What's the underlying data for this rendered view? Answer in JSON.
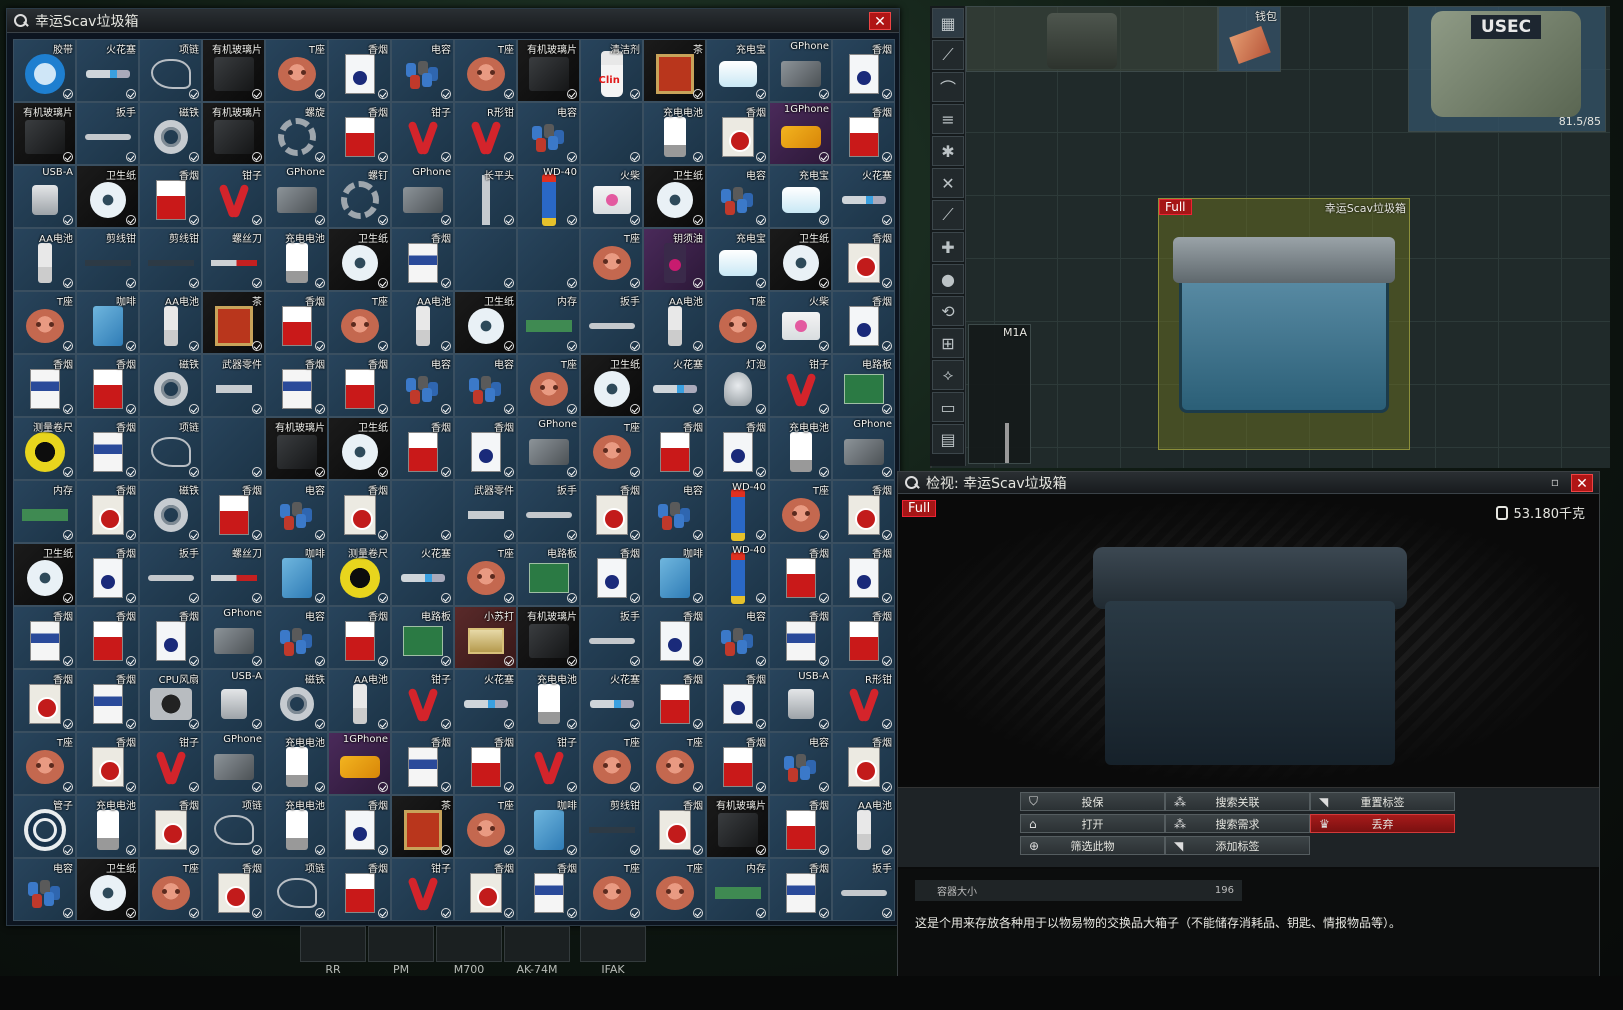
{
  "container_window": {
    "title": "幸运Scav垃圾箱",
    "close_label": "✕",
    "grid": [
      [
        "胶带",
        "火花塞",
        "项链",
        "有机玻璃片",
        "T座",
        "香烟",
        "电容",
        "T座",
        "有机玻璃片",
        "清洁剂",
        "茶",
        "充电宝",
        "GPhone",
        "香烟"
      ],
      [
        "有机玻璃片",
        "扳手",
        "磁铁",
        "有机玻璃片",
        "螺旋",
        "香烟",
        "钳子",
        "R形钳",
        "电容",
        "",
        "充电电池",
        "香烟",
        "1GPhone",
        "香烟"
      ],
      [
        "USB-A",
        "卫生纸",
        "香烟",
        "钳子",
        "GPhone",
        "螺钉",
        "GPhone",
        "长平头",
        "WD-40",
        "火柴",
        "卫生纸",
        "电容",
        "充电宝",
        "火花塞"
      ],
      [
        "AA电池",
        "剪线钳",
        "剪线钳",
        "螺丝刀",
        "充电电池",
        "卫生纸",
        "香烟",
        "",
        "",
        "T座",
        "钥须油",
        "充电宝",
        "卫生纸",
        "香烟"
      ],
      [
        "T座",
        "咖啡",
        "AA电池",
        "茶",
        "香烟",
        "T座",
        "AA电池",
        "卫生纸",
        "内存",
        "扳手",
        "AA电池",
        "T座",
        "火柴",
        "香烟"
      ],
      [
        "香烟",
        "香烟",
        "磁铁",
        "武器零件",
        "香烟",
        "香烟",
        "电容",
        "电容",
        "T座",
        "卫生纸",
        "火花塞",
        "灯泡",
        "钳子",
        "电路板"
      ],
      [
        "测量卷尺",
        "香烟",
        "项链",
        "",
        "有机玻璃片",
        "卫生纸",
        "香烟",
        "香烟",
        "GPhone",
        "T座",
        "香烟",
        "香烟",
        "充电电池",
        "GPhone"
      ],
      [
        "内存",
        "香烟",
        "磁铁",
        "香烟",
        "电容",
        "香烟",
        "",
        "武器零件",
        "扳手",
        "香烟",
        "电容",
        "WD-40",
        "T座",
        "香烟"
      ],
      [
        "卫生纸",
        "香烟",
        "扳手",
        "螺丝刀",
        "咖啡",
        "测量卷尺",
        "火花塞",
        "T座",
        "电路板",
        "香烟",
        "咖啡",
        "WD-40",
        "香烟",
        "香烟"
      ],
      [
        "香烟",
        "香烟",
        "香烟",
        "GPhone",
        "电容",
        "香烟",
        "电路板",
        "小苏打",
        "有机玻璃片",
        "扳手",
        "香烟",
        "电容",
        "香烟",
        "香烟"
      ],
      [
        "香烟",
        "香烟",
        "CPU风扇",
        "USB-A",
        "磁铁",
        "AA电池",
        "钳子",
        "火花塞",
        "充电电池",
        "火花塞",
        "香烟",
        "香烟",
        "USB-A",
        "R形钳"
      ],
      [
        "T座",
        "香烟",
        "钳子",
        "GPhone",
        "充电电池",
        "1GPhone",
        "香烟",
        "香烟",
        "钳子",
        "T座",
        "T座",
        "香烟",
        "电容",
        "香烟"
      ],
      [
        "管子",
        "充电电池",
        "香烟",
        "项链",
        "充电电池",
        "香烟",
        "茶",
        "T座",
        "咖啡",
        "剪线钳",
        "香烟",
        "有机玻璃片",
        "香烟",
        "AA电池"
      ],
      [
        "电容",
        "卫生纸",
        "T座",
        "香烟",
        "项链",
        "香烟",
        "钳子",
        "香烟",
        "香烟",
        "T座",
        "T座",
        "内存",
        "香烟",
        "扳手"
      ]
    ]
  },
  "stash": {
    "wallet_label": "钱包",
    "armor_label": "USEC",
    "armor_durability": "81.5/85",
    "weapon_slot_label": "M1A",
    "container_slot_label": "幸运Scav垃圾箱",
    "full_badge": "Full"
  },
  "sidebar": {
    "icons": [
      "grid-icon",
      "rifle-icon",
      "magazine-icon",
      "ammo-icon",
      "gear-icon",
      "crossed-tools-icon",
      "knife-icon",
      "medical-icon",
      "grenade-icon",
      "swap-icon",
      "wrench-kit-icon",
      "barter-icon",
      "suitcase-icon",
      "scroll-icon"
    ],
    "glyphs": [
      "▦",
      "⟋",
      "⌒",
      "≡",
      "✱",
      "✕",
      "⟋",
      "✚",
      "●",
      "⟲",
      "⊞",
      "⟡",
      "▭",
      "▤"
    ]
  },
  "inspect_window": {
    "title": "检视: 幸运Scav垃圾箱",
    "full_badge": "Full",
    "weight": "53.180千克",
    "minimize_label": "▫",
    "close_label": "✕",
    "actions": [
      {
        "label": "投保",
        "icon": "⛉"
      },
      {
        "label": "搜索关联",
        "icon": "⁂"
      },
      {
        "label": "重置标签",
        "icon": "◥"
      },
      {
        "label": "打开",
        "icon": "⌂"
      },
      {
        "label": "搜索需求",
        "icon": "⁂"
      },
      {
        "label": "丢弃",
        "icon": "♛"
      },
      {
        "label": "筛选此物",
        "icon": "⊕"
      },
      {
        "label": "添加标签",
        "icon": "◥"
      }
    ],
    "capacity_label": "容器大小",
    "capacity_value": "196",
    "description": "这是个用来存放各种用于以物易物的交换品大箱子（不能储存消耗品、钥匙、情报物品等）。"
  },
  "hotbar": {
    "slots": [
      "RR",
      "PM",
      "M700",
      "AK-74M",
      "IFAK"
    ]
  },
  "colors": {
    "cell_bg": "#28445c",
    "danger": "#a71b1b",
    "full_badge": "#a51616",
    "slot_highlight": "#737a1e"
  }
}
